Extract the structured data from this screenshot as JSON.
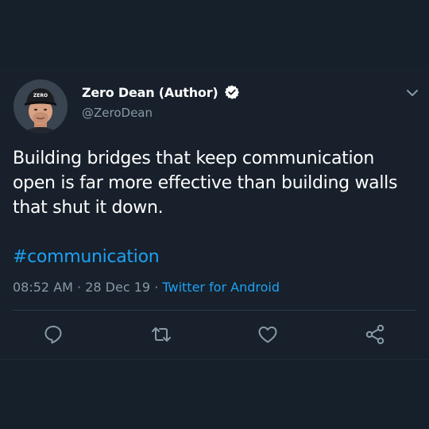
{
  "tweet": {
    "author_name": "Zero Dean (Author)",
    "handle": "@ZeroDean",
    "avatar_cap_text": "ZERO",
    "text_lines": [
      "Building bridges that keep communication",
      "open is far more effective than building walls",
      "that shut it down."
    ],
    "hashtag": "#communication",
    "time": "08:52 AM",
    "date": "28 Dec 19",
    "source": "Twitter for Android",
    "separator": "·"
  },
  "icons": {
    "verified": "verified-badge-icon",
    "menu": "chevron-down-icon",
    "reply": "reply-icon",
    "retweet": "retweet-icon",
    "like": "heart-icon",
    "share": "share-icon"
  },
  "colors": {
    "background": "#15202b",
    "text": "#ffffff",
    "secondary": "#8899a6",
    "accent": "#1da1f2"
  }
}
